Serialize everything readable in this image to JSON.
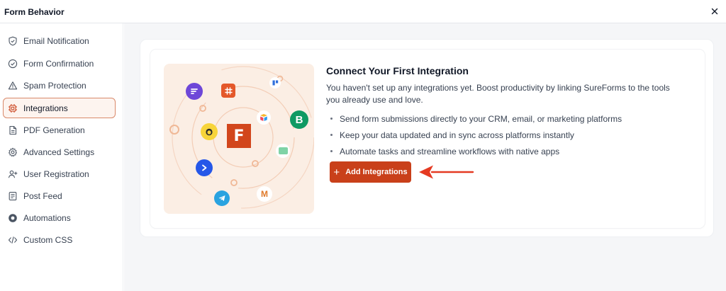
{
  "header": {
    "title": "Form Behavior",
    "close_icon": "close-icon"
  },
  "sidebar": {
    "items": [
      {
        "label": "Email Notification",
        "icon": "shield-check-icon"
      },
      {
        "label": "Form Confirmation",
        "icon": "check-circle-icon"
      },
      {
        "label": "Spam Protection",
        "icon": "warning-triangle-icon"
      },
      {
        "label": "Integrations",
        "icon": "chip-icon",
        "active": true
      },
      {
        "label": "PDF Generation",
        "icon": "document-icon"
      },
      {
        "label": "Advanced Settings",
        "icon": "gear-icon"
      },
      {
        "label": "User Registration",
        "icon": "user-plus-icon"
      },
      {
        "label": "Post Feed",
        "icon": "post-feed-icon"
      },
      {
        "label": "Automations",
        "icon": "automation-icon"
      },
      {
        "label": "Custom CSS",
        "icon": "code-icon"
      }
    ]
  },
  "main": {
    "title": "Connect Your First Integration",
    "description": "You haven't set up any integrations yet. Boost productivity by linking SureForms to the tools you already use and love.",
    "bullets": [
      "Send form submissions directly to your CRM, email, or marketing platforms",
      "Keep your data updated and in sync across platforms instantly",
      "Automate tasks and streamline workflows with native apps"
    ],
    "button_label": "Add Integrations",
    "illustration": {
      "center_logo_letter": "F",
      "app_letters": [
        "B",
        "M"
      ]
    }
  },
  "colors": {
    "accent": "#c9401a",
    "active_border": "#d9896a",
    "active_bg": "#fdf4ef",
    "arrow": "#e53a22",
    "illustration_bg": "#fbeee4"
  }
}
